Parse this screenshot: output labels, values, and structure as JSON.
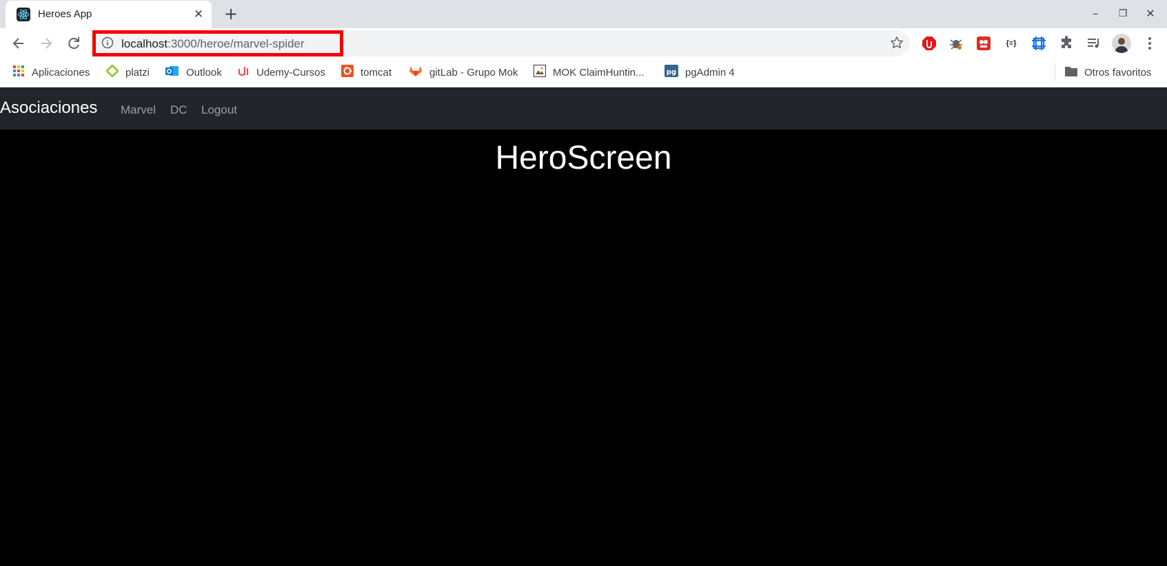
{
  "browser": {
    "tab_title": "Heroes App",
    "tab_close_glyph": "✕",
    "new_tab_glyph": "+",
    "window_controls": {
      "minimize": "–",
      "restore": "❐",
      "close": "✕"
    },
    "url_host": "localhost",
    "url_path": ":3000/heroe/marvel-spider",
    "highlight_color": "#f30000"
  },
  "bookmarks": [
    {
      "label": "Aplicaciones",
      "icon": "apps-grid-icon",
      "color": "#ea4335"
    },
    {
      "label": "platzi",
      "icon": "platzi-icon",
      "color": "#98ca3f"
    },
    {
      "label": "Outlook",
      "icon": "outlook-icon",
      "color": "#0078d4"
    },
    {
      "label": "Udemy-Cursos",
      "icon": "udemy-icon",
      "color": "#ec5252"
    },
    {
      "label": "tomcat",
      "icon": "ubuntu-icon",
      "color": "#e95420"
    },
    {
      "label": "gitLab - Grupo Mok",
      "icon": "gitlab-icon",
      "color": "#fc6d26"
    },
    {
      "label": "MOK ClaimHuntin...",
      "icon": "image-icon",
      "color": "#7a5c3a"
    },
    {
      "label": "pgAdmin 4",
      "icon": "pgadmin-icon",
      "color": "#326690"
    }
  ],
  "other_bookmarks": "Otros favoritos",
  "app": {
    "brand": "Asociaciones",
    "links": [
      "Marvel",
      "DC",
      "Logout"
    ],
    "navbar_color": "#212529",
    "heading": "HeroScreen"
  }
}
